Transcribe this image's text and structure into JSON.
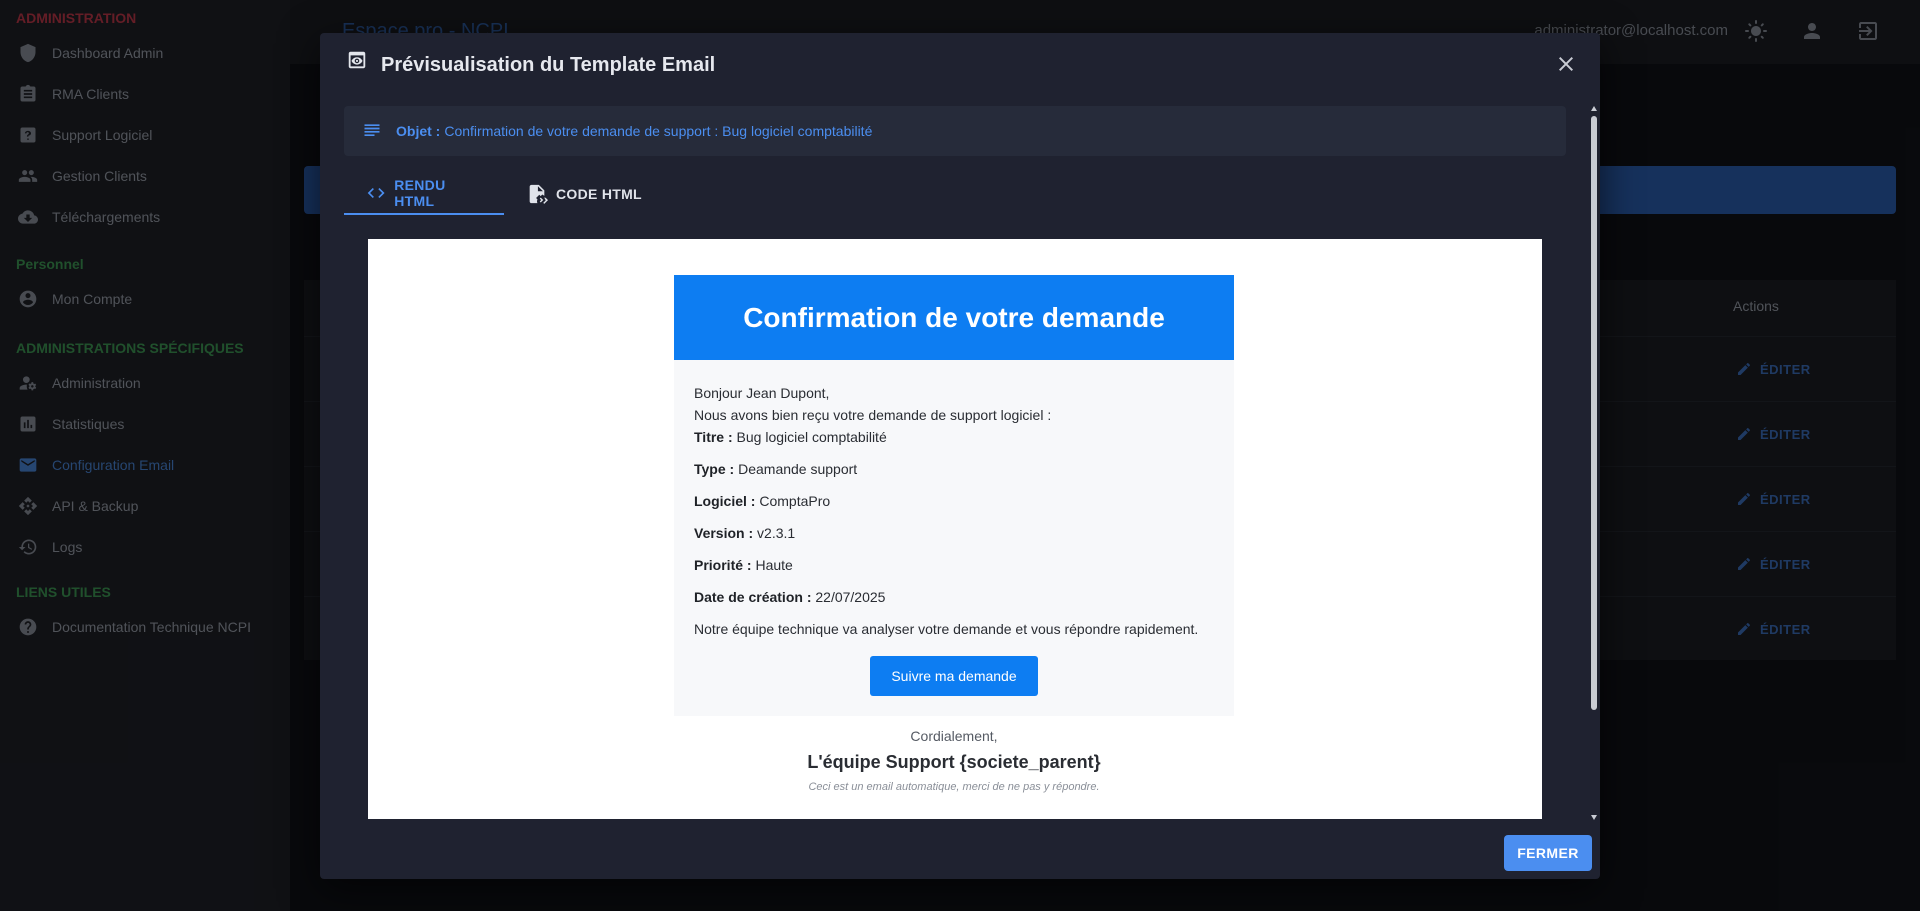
{
  "sidebar": {
    "sections": [
      {
        "title": "ADMINISTRATION",
        "items": [
          {
            "label": "Dashboard Admin",
            "icon": "shield-icon"
          },
          {
            "label": "RMA Clients",
            "icon": "clipboard-icon"
          },
          {
            "label": "Support Logiciel",
            "icon": "help-box-icon"
          },
          {
            "label": "Gestion Clients",
            "icon": "people-icon"
          },
          {
            "label": "Téléchargements",
            "icon": "cloud-download-icon"
          }
        ]
      },
      {
        "title": "Personnel",
        "items": [
          {
            "label": "Mon Compte",
            "icon": "account-circle-icon"
          }
        ]
      },
      {
        "title": "ADMINISTRATIONS SPÉCIFIQUES",
        "items": [
          {
            "label": "Administration",
            "icon": "user-gear-icon"
          },
          {
            "label": "Statistiques",
            "icon": "bar-chart-icon"
          },
          {
            "label": "Configuration Email",
            "icon": "mail-icon",
            "active": true
          },
          {
            "label": "API & Backup",
            "icon": "api-icon"
          },
          {
            "label": "Logs",
            "icon": "history-icon"
          }
        ]
      },
      {
        "title": "LIENS UTILES",
        "items": [
          {
            "label": "Documentation Technique NCPI",
            "icon": "help-circle-icon"
          }
        ]
      }
    ]
  },
  "topbar": {
    "title": "Espace pro - NCPI",
    "user_email": "administrator@localhost.com"
  },
  "table": {
    "actions_header": "Actions",
    "edit_label": "ÉDITER"
  },
  "modal": {
    "title": "Prévisualisation du Template Email",
    "subject_label": "Objet :",
    "subject_value": "Confirmation de votre demande de support : Bug logiciel comptabilité",
    "tabs": [
      {
        "label": "RENDU HTML",
        "icon": "code-icon",
        "active": true
      },
      {
        "label": "CODE HTML",
        "icon": "file-code-icon",
        "active": false
      }
    ],
    "close_label": "FERMER"
  },
  "email": {
    "header": "Confirmation de votre demande",
    "greeting": "Bonjour Jean Dupont,",
    "intro": "Nous avons bien reçu votre demande de support logiciel :",
    "fields": [
      {
        "label": "Titre :",
        "value": "Bug logiciel comptabilité"
      },
      {
        "label": "Type :",
        "value": "Deamande support"
      },
      {
        "label": "Logiciel :",
        "value": "ComptaPro"
      },
      {
        "label": "Version :",
        "value": "v2.3.1"
      },
      {
        "label": "Priorité :",
        "value": "Haute"
      },
      {
        "label": "Date de création :",
        "value": "22/07/2025"
      }
    ],
    "closing_text": "Notre équipe technique va analyser votre demande et vous répondre rapidement.",
    "cta_label": "Suivre ma demande",
    "regards": "Cordialement,",
    "team": "L'équipe Support {societe_parent}",
    "auto_note": "Ceci est un email automatique, merci de ne pas y répondre."
  },
  "colors": {
    "accent": "#4b8ef0",
    "email_brand": "#0d7df2",
    "modal_bg": "#1f2230",
    "admin_section": "#c0394a",
    "personal_section": "#3f9a55"
  }
}
